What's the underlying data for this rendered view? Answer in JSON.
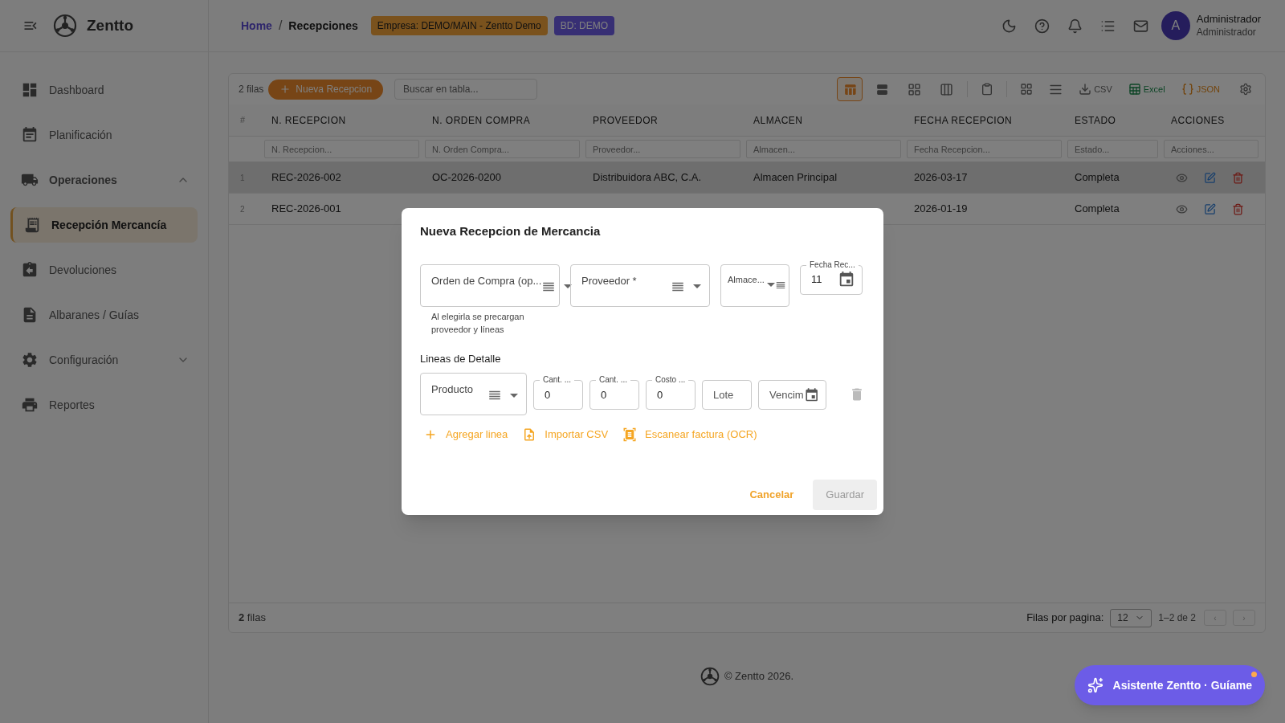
{
  "brand": {
    "name": "Zentto"
  },
  "sidebar": {
    "items": [
      {
        "label": "Dashboard",
        "selected": false
      },
      {
        "label": "Planificación",
        "selected": false
      },
      {
        "label": "Operaciones",
        "selected": false,
        "expanded": true,
        "children": [
          {
            "label": "Recepción Mercancía",
            "selected": true
          },
          {
            "label": "Devoluciones",
            "selected": false
          },
          {
            "label": "Albaranes / Guías",
            "selected": false
          }
        ]
      },
      {
        "label": "Configuración",
        "selected": false,
        "expanded": false
      },
      {
        "label": "Reportes",
        "selected": false
      }
    ]
  },
  "header": {
    "breadcrumb_separator": "/",
    "breadcrumbs": [
      {
        "label": "Home",
        "kind": "link"
      },
      {
        "label": "Recepciones",
        "kind": "current"
      }
    ],
    "badges": [
      {
        "label": "Empresa: DEMO/MAIN - Zentto Demo",
        "kind": "company"
      },
      {
        "label": "BD: DEMO",
        "kind": "database"
      }
    ],
    "user": {
      "initial": "A",
      "name": "Administrador",
      "role": "Administrador"
    }
  },
  "toolbar": {
    "row_count": "2 filas",
    "add_button": "Nueva Recepcion",
    "search": {
      "placeholder": "Buscar en tabla..."
    },
    "views": [
      {
        "selected": true
      },
      {
        "selected": false
      },
      {
        "selected": false
      },
      {
        "selected": false
      }
    ],
    "exports": [
      {
        "label": "CSV",
        "kind": "csv"
      },
      {
        "label": "Excel",
        "kind": "excel"
      },
      {
        "label": "JSON",
        "kind": "json"
      }
    ]
  },
  "table": {
    "index_header": "#",
    "columns": [
      {
        "label": "N. RECEPCION",
        "placeholder": "N. Recepcion..."
      },
      {
        "label": "N. ORDEN COMPRA",
        "placeholder": "N. Orden Compra..."
      },
      {
        "label": "PROVEEDOR",
        "placeholder": "Proveedor..."
      },
      {
        "label": "ALMACEN",
        "placeholder": "Almacen..."
      },
      {
        "label": "FECHA RECEPCION",
        "placeholder": "Fecha Recepcion..."
      },
      {
        "label": "ESTADO",
        "placeholder": "Estado..."
      },
      {
        "label": "ACCIONES",
        "placeholder": "Acciones..."
      }
    ],
    "rows": [
      {
        "index": "1",
        "selected": true,
        "recepcion": "REC-2026-002",
        "orden": "OC-2026-0200",
        "proveedor": "Distribuidora ABC, C.A.",
        "almacen": "Almacen Principal",
        "fecha": "2026-03-17",
        "estado": "Completa"
      },
      {
        "index": "2",
        "selected": false,
        "recepcion": "REC-2026-001",
        "fecha": "2026-01-19",
        "estado": "Completa"
      }
    ],
    "footer": {
      "count": "**2** filas",
      "rows_per_page_label": "Filas por pagina:",
      "rows_per_page": "12",
      "range": "1–2 de 2",
      "prev": "‹",
      "next": "›"
    }
  },
  "copyright": "© Zentto 2026.",
  "assistant": {
    "label": "Asistente Zentto · Guíame",
    "notification": true
  },
  "dialog": {
    "title": "Nueva Recepcion de Mercancia",
    "fields": [
      {
        "kind": "select",
        "label": "Orden de Compra (op...",
        "helper": "Al elegirla se precargan proveedor y líneas"
      },
      {
        "kind": "select",
        "label": "Proveedor *"
      },
      {
        "kind": "select",
        "label": "Almace..."
      },
      {
        "kind": "date",
        "label": "Fecha Rec...",
        "value": "11"
      }
    ],
    "section_title": "Lineas de Detalle",
    "line_fields": [
      {
        "kind": "select",
        "label": "Producto"
      },
      {
        "kind": "number",
        "label": "Cant. ...",
        "value": "0"
      },
      {
        "kind": "number",
        "label": "Cant. ...",
        "value": "0"
      },
      {
        "kind": "number",
        "label": "Costo ...",
        "value": "0"
      },
      {
        "kind": "text",
        "placeholder": "Lote"
      },
      {
        "kind": "date_empty",
        "placeholder": "Vencim"
      }
    ],
    "actions": [
      {
        "label": "Agregar linea",
        "kind": "add"
      },
      {
        "label": "Importar CSV",
        "kind": "import"
      },
      {
        "label": "Escanear factura (OCR)",
        "kind": "scan"
      }
    ],
    "cancel": "Cancelar",
    "save": {
      "label": "Guardar",
      "disabled": true
    }
  }
}
